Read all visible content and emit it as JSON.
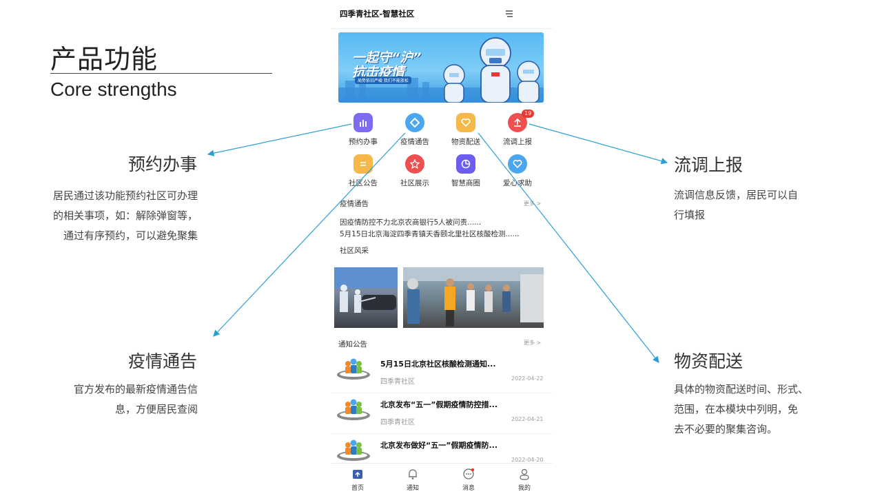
{
  "slide": {
    "title": "产品功能",
    "subtitle": "Core strengths"
  },
  "features": {
    "booking": {
      "title": "预约办事",
      "desc": [
        "居民通过该功能预约社区可办理",
        "的相关事项，如：解除弹窗等，",
        "通过有序预约，可以避免聚集"
      ]
    },
    "epidemic": {
      "title": "疫情通告",
      "desc": [
        "官方发布的最新疫情通告信",
        "息，方便居民查阅"
      ]
    },
    "report": {
      "title": "流调上报",
      "desc": [
        "流调信息反馈，居民可以自",
        "行填报"
      ]
    },
    "delivery": {
      "title": "物资配送",
      "desc": [
        "具体的物资配送时间、形式、",
        "范围，在本模块中列明，免",
        "去不必要的聚集咨询。"
      ]
    }
  },
  "app": {
    "title": "四季青社区-智慧社区",
    "banner": {
      "line1": "一起守“沪”",
      "line2": "抗击疫情",
      "line3": "局势依旧严峻 我们不能放松"
    },
    "grid": [
      {
        "label": "预约办事",
        "icon": "bar-chart-icon",
        "color": "#7b6cf0"
      },
      {
        "label": "疫情通告",
        "icon": "diamond-icon",
        "color": "#4aa6ef"
      },
      {
        "label": "物资配送",
        "icon": "heart-icon",
        "color": "#f5b84a"
      },
      {
        "label": "流调上报",
        "icon": "upload-icon",
        "color": "#ef4f4f",
        "badge": "19"
      },
      {
        "label": "社区公告",
        "icon": "document-icon",
        "color": "#f5b84a"
      },
      {
        "label": "社区展示",
        "icon": "star-icon",
        "color": "#ef4f4f"
      },
      {
        "label": "智慧商圈",
        "icon": "pie-chart-icon",
        "color": "#6c5df0"
      },
      {
        "label": "爱心求助",
        "icon": "heart-icon",
        "color": "#4aa6ef"
      }
    ],
    "epidemic_section": {
      "title": "疫情通告",
      "more": "更多",
      "items": [
        "因疫情防控不力北京农商银行5人被问责......",
        "5月15日北京海淀四季青镇天香颐北里社区核酸检测......"
      ]
    },
    "community_section": {
      "title": "社区风采"
    },
    "notice_section": {
      "title": "通知公告",
      "more": "更多",
      "items": [
        {
          "title": "5月15日北京社区核酸检测通知...",
          "source": "四季青社区",
          "date": "2022-04-22"
        },
        {
          "title": "北京发布“五一”假期疫情防控措...",
          "source": "四季青社区",
          "date": "2022-04-21"
        },
        {
          "title": "北京发布做好“五一”假期疫情防...",
          "source": "",
          "date": "2022-04-20"
        }
      ]
    },
    "tabbar": [
      {
        "label": "首页",
        "icon": "home-icon"
      },
      {
        "label": "通知",
        "icon": "bell-icon"
      },
      {
        "label": "消息",
        "icon": "chat-icon"
      },
      {
        "label": "我的",
        "icon": "user-icon"
      }
    ],
    "colors": {
      "accent": "#3b5fad",
      "arrow": "#2a9fd6"
    }
  }
}
